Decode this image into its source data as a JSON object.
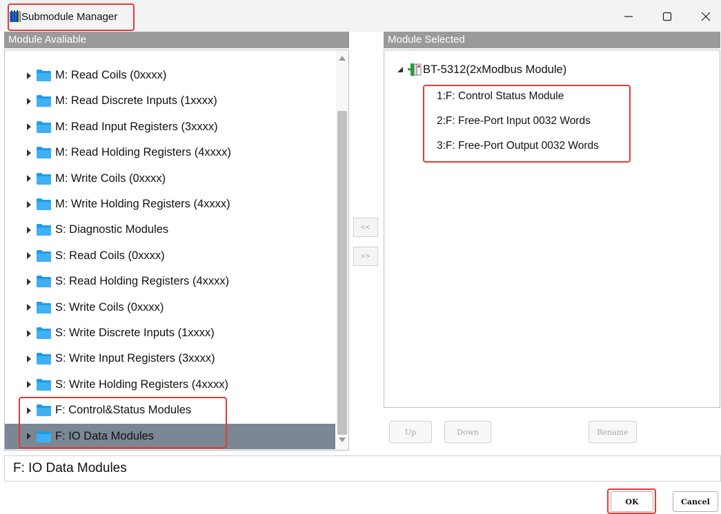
{
  "window": {
    "title": "Submodule Manager",
    "controls": [
      "minimize-icon",
      "maximize-icon",
      "close-icon"
    ]
  },
  "left_panel": {
    "header": "Module Avaliable",
    "items": [
      {
        "label": "M: Read Coils (0xxxx)"
      },
      {
        "label": "M: Read Discrete Inputs (1xxxx)"
      },
      {
        "label": "M: Read Input Registers (3xxxx)"
      },
      {
        "label": "M: Read Holding Registers (4xxxx)"
      },
      {
        "label": "M: Write Coils (0xxxx)"
      },
      {
        "label": "M: Write Holding Registers (4xxxx)"
      },
      {
        "label": "S: Diagnostic Modules"
      },
      {
        "label": "S: Read Coils (0xxxx)"
      },
      {
        "label": "S: Read Holding Registers (4xxxx)"
      },
      {
        "label": "S: Write Coils (0xxxx)"
      },
      {
        "label": "S: Write Discrete Inputs (1xxxx)"
      },
      {
        "label": "S: Write Input Registers (3xxxx)"
      },
      {
        "label": "S: Write Holding Registers (4xxxx)"
      },
      {
        "label": "F: Control&Status Modules"
      },
      {
        "label": "F: IO Data Modules",
        "selected": true
      }
    ]
  },
  "middle_buttons": {
    "remove_label": "<<",
    "add_label": ">>"
  },
  "right_panel": {
    "header": "Module Selected",
    "root": "BT-5312(2xModbus Module)",
    "children": [
      "1:F: Control Status Module",
      "2:F: Free-Port Input 0032 Words",
      "3:F: Free-Port Output 0032 Words"
    ]
  },
  "bottom_buttons": {
    "up": "Up",
    "down": "Down",
    "rename": "Rename",
    "ok": "OK",
    "cancel": "Cancel"
  },
  "status_text": "F: IO Data Modules",
  "colors": {
    "panel_header": "#9a9a9a",
    "selected_row": "#7b8794",
    "folder": "#1e9be8",
    "annotation": "#e53935"
  }
}
